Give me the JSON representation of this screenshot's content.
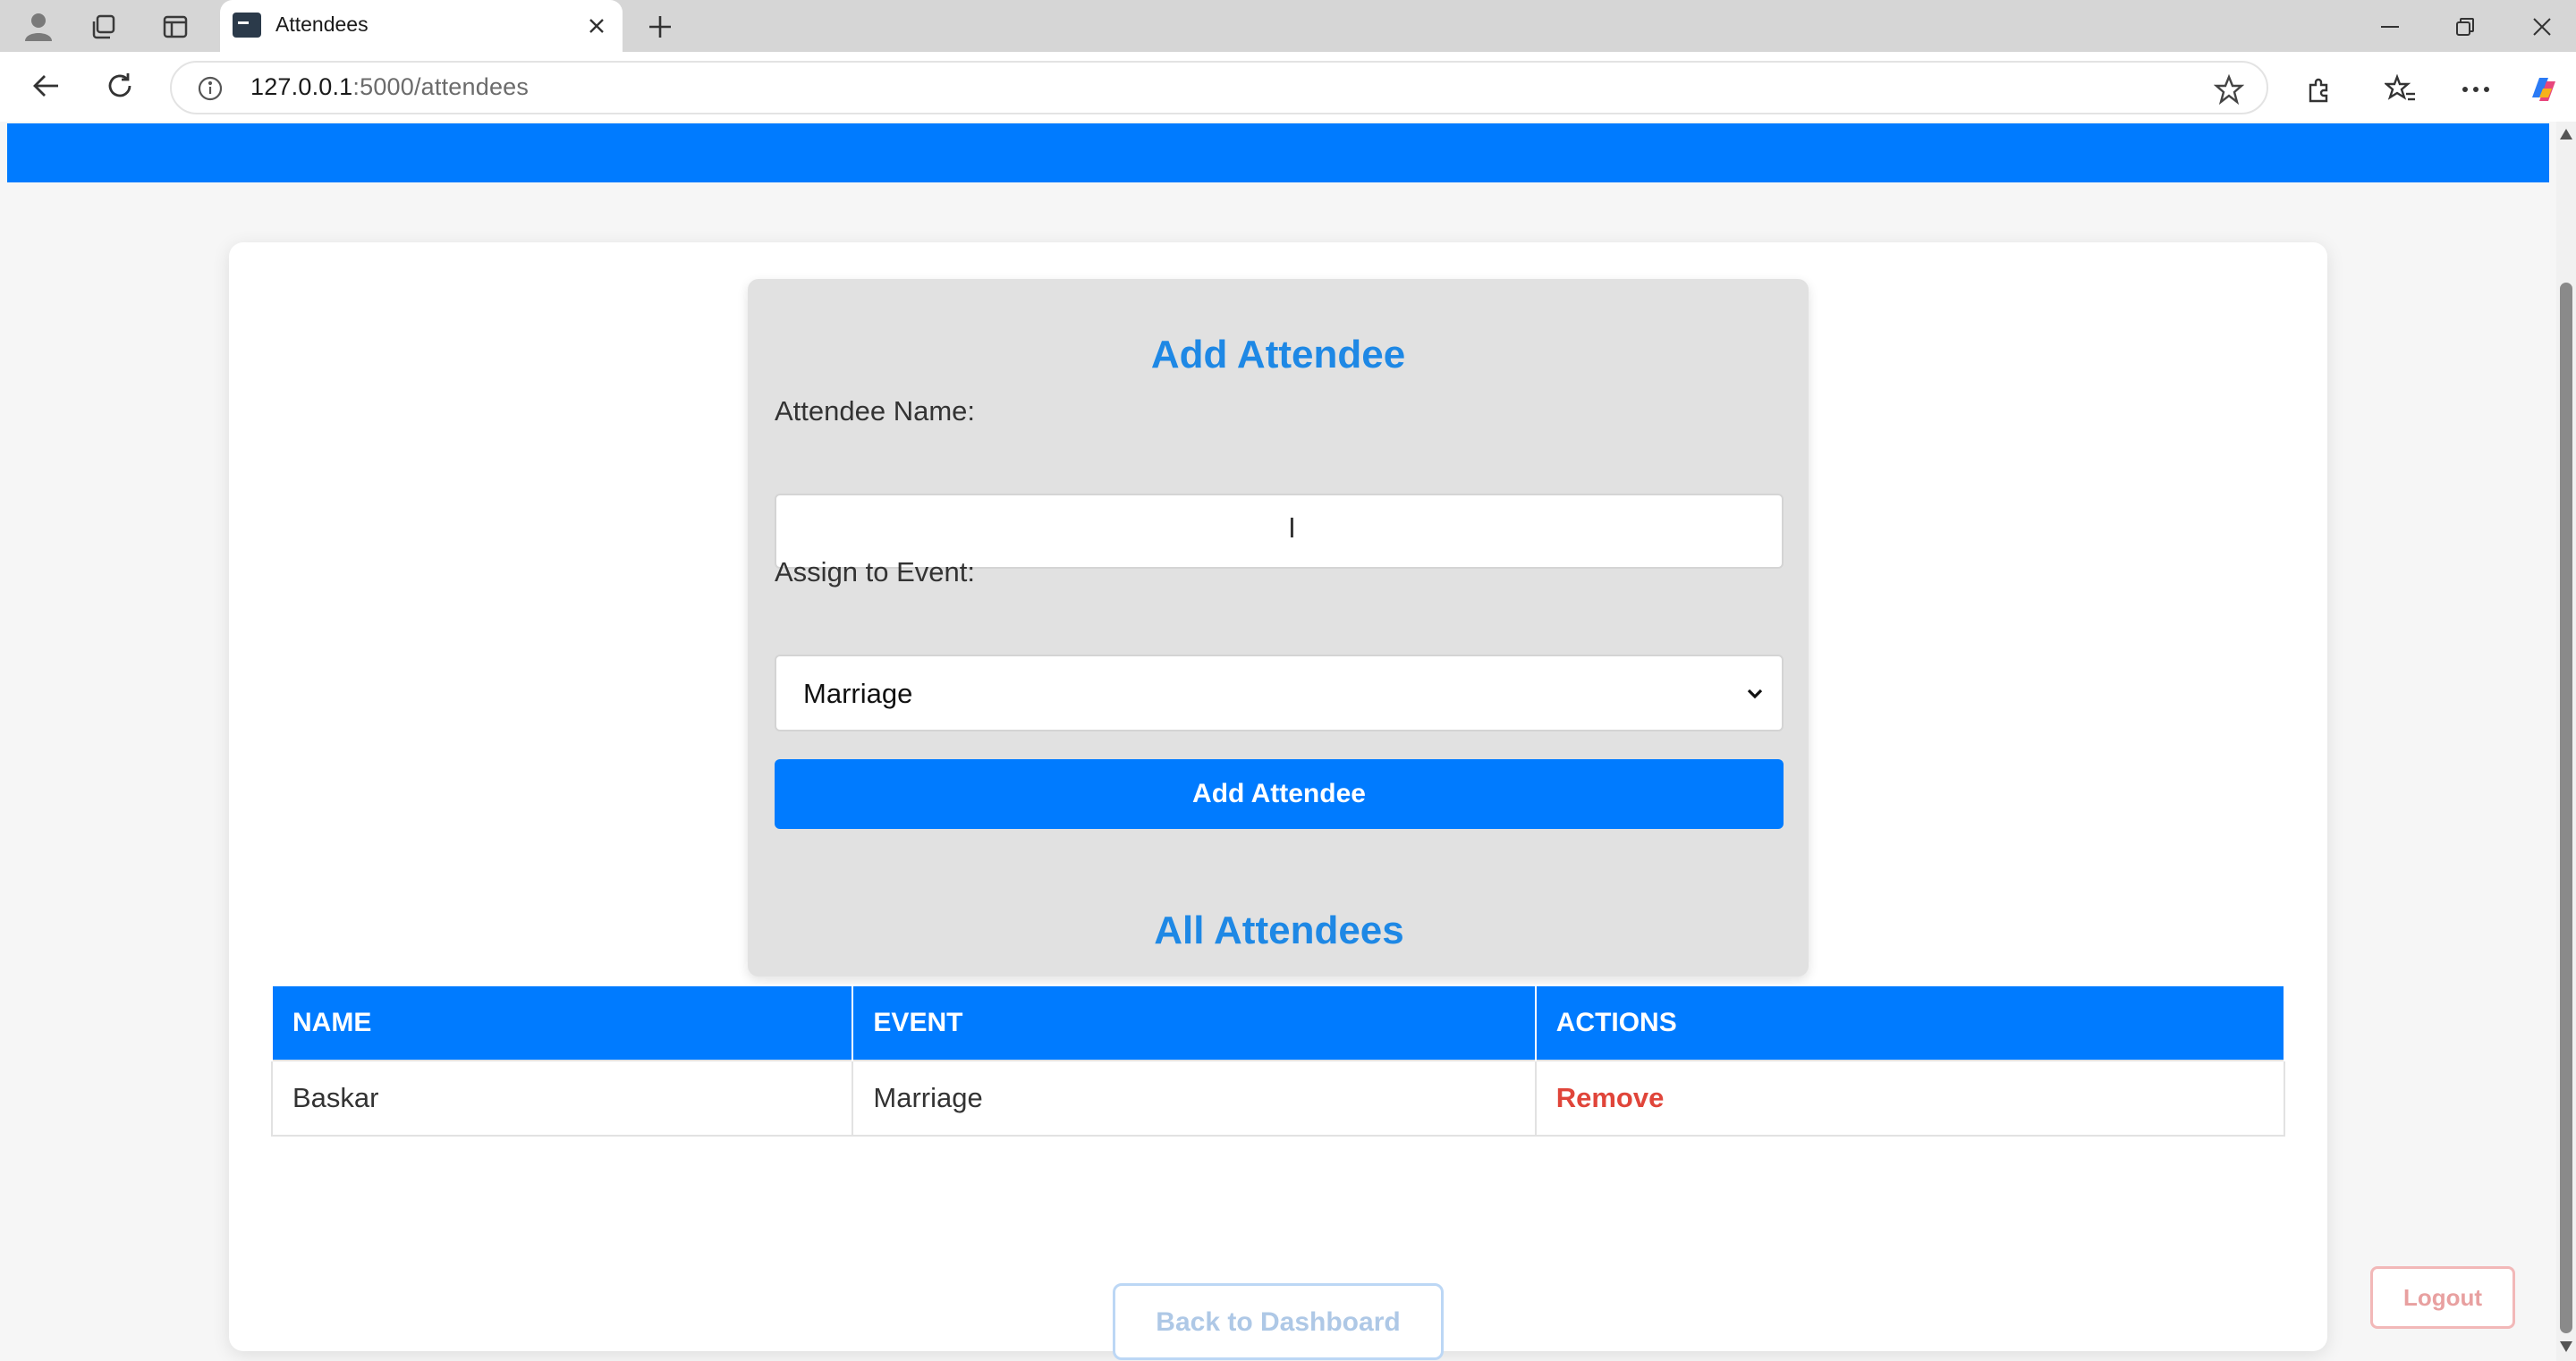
{
  "browser": {
    "tab_title": "Attendees",
    "url_host": "127.0.0.1",
    "url_rest": ":5000/attendees"
  },
  "form": {
    "title": "Add Attendee",
    "name_label": "Attendee Name:",
    "name_value": "",
    "event_label": "Assign to Event:",
    "event_selected": "Marriage",
    "submit_label": "Add Attendee"
  },
  "list": {
    "title": "All Attendees",
    "columns": [
      "NAME",
      "EVENT",
      "ACTIONS"
    ],
    "rows": [
      {
        "name": "Baskar",
        "event": "Marriage",
        "action": "Remove"
      }
    ]
  },
  "footer": {
    "back_label": "Back to Dashboard",
    "logout_label": "Logout"
  },
  "colors": {
    "primary": "#007bff",
    "heading": "#1e88e5",
    "danger": "#e0453a"
  }
}
